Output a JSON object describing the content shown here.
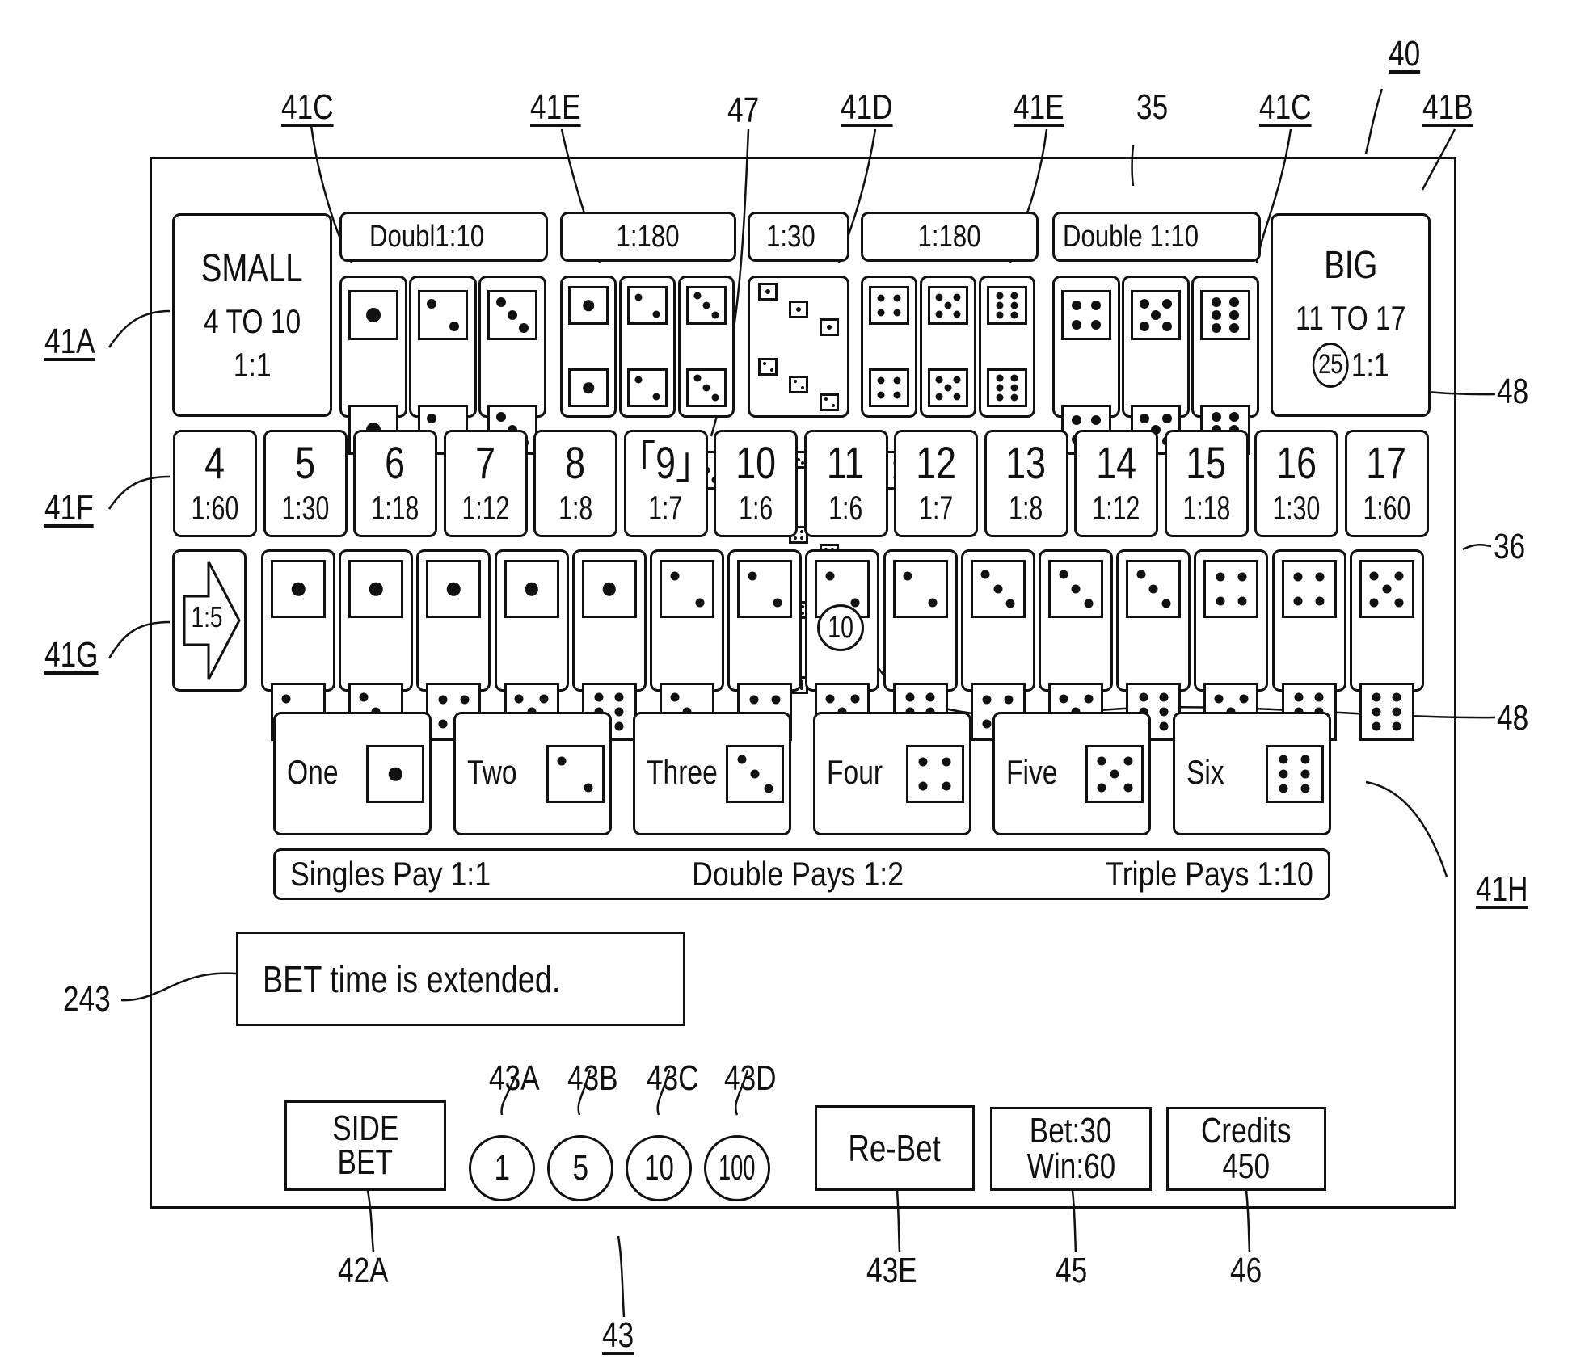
{
  "reference_labels": {
    "fig": "40",
    "big_area": "41B",
    "small_area": "41A",
    "double_left": "41C",
    "triple_left": "41E",
    "pointer_47": "47",
    "any_triple": "41D",
    "triple_right": "41E",
    "region_35": "35",
    "double_right": "41C",
    "number_row": "41F",
    "region_36": "36",
    "combo_row": "41G",
    "chip_48_top": "48",
    "chip_48_mid": "48",
    "singles_row": "41H",
    "message": "243",
    "side_bet": "42A",
    "chip_1": "43A",
    "chip_5": "43B",
    "chip_10": "43C",
    "chip_100": "43D",
    "chips_group": "43",
    "rebet": "43E",
    "bet_win": "45",
    "credits": "46"
  },
  "small": {
    "title": "SMALL",
    "range": "4 TO 10",
    "payout": "1:1"
  },
  "big": {
    "title": "BIG",
    "range": "11 TO 17",
    "payout": "1:1",
    "chip": "25"
  },
  "top_headers": [
    {
      "label": "Doubl1:10"
    },
    {
      "label": "1:180"
    },
    {
      "label": "1:30"
    },
    {
      "label": "1:180"
    },
    {
      "label": "Double 1:10"
    }
  ],
  "doubles_left": [
    1,
    2,
    3
  ],
  "triples_left": [
    1,
    2,
    3
  ],
  "any_triple": [
    [
      1,
      1,
      1
    ],
    [
      2,
      2,
      2
    ],
    [
      3,
      3,
      3
    ],
    [
      4,
      4,
      4
    ],
    [
      5,
      5,
      5
    ],
    [
      6,
      6,
      6
    ]
  ],
  "triples_right": [
    4,
    5,
    6
  ],
  "doubles_right": [
    4,
    5,
    6
  ],
  "totals": [
    {
      "number": "4",
      "payout": "1:60"
    },
    {
      "number": "5",
      "payout": "1:30"
    },
    {
      "number": "6",
      "payout": "1:18"
    },
    {
      "number": "7",
      "payout": "1:12"
    },
    {
      "number": "8",
      "payout": "1:8"
    },
    {
      "number": "「9」",
      "payout": "1:7"
    },
    {
      "number": "10",
      "payout": "1:6"
    },
    {
      "number": "11",
      "payout": "1:6"
    },
    {
      "number": "12",
      "payout": "1:7"
    },
    {
      "number": "13",
      "payout": "1:8"
    },
    {
      "number": "14",
      "payout": "1:12"
    },
    {
      "number": "15",
      "payout": "1:18"
    },
    {
      "number": "16",
      "payout": "1:30"
    },
    {
      "number": "17",
      "payout": "1:60"
    }
  ],
  "combo_payout": "1:5",
  "combos": [
    [
      1,
      2
    ],
    [
      1,
      3
    ],
    [
      1,
      4
    ],
    [
      1,
      5
    ],
    [
      1,
      6
    ],
    [
      2,
      3
    ],
    [
      2,
      4
    ],
    [
      2,
      5
    ],
    [
      2,
      6
    ],
    [
      3,
      4
    ],
    [
      3,
      5
    ],
    [
      3,
      6
    ],
    [
      4,
      5
    ],
    [
      4,
      6
    ],
    [
      5,
      6
    ]
  ],
  "combo_chip": {
    "index": 7,
    "value": "10"
  },
  "singles": [
    {
      "label": "One",
      "face": 1
    },
    {
      "label": "Two",
      "face": 2
    },
    {
      "label": "Three",
      "face": 3
    },
    {
      "label": "Four",
      "face": 4
    },
    {
      "label": "Five",
      "face": 5
    },
    {
      "label": "Six",
      "face": 6
    }
  ],
  "pays_bar": {
    "singles": "Singles Pay 1:1",
    "double": "Double Pays 1:2",
    "triple": "Triple Pays 1:10"
  },
  "message": "BET time is extended.",
  "bottom": {
    "side_bet_line1": "SIDE",
    "side_bet_line2": "BET",
    "chips": [
      "1",
      "5",
      "10",
      "100"
    ],
    "rebet": "Re-Bet",
    "bet": "Bet:30",
    "win": "Win:60",
    "credits_label": "Credits",
    "credits_value": "450"
  }
}
